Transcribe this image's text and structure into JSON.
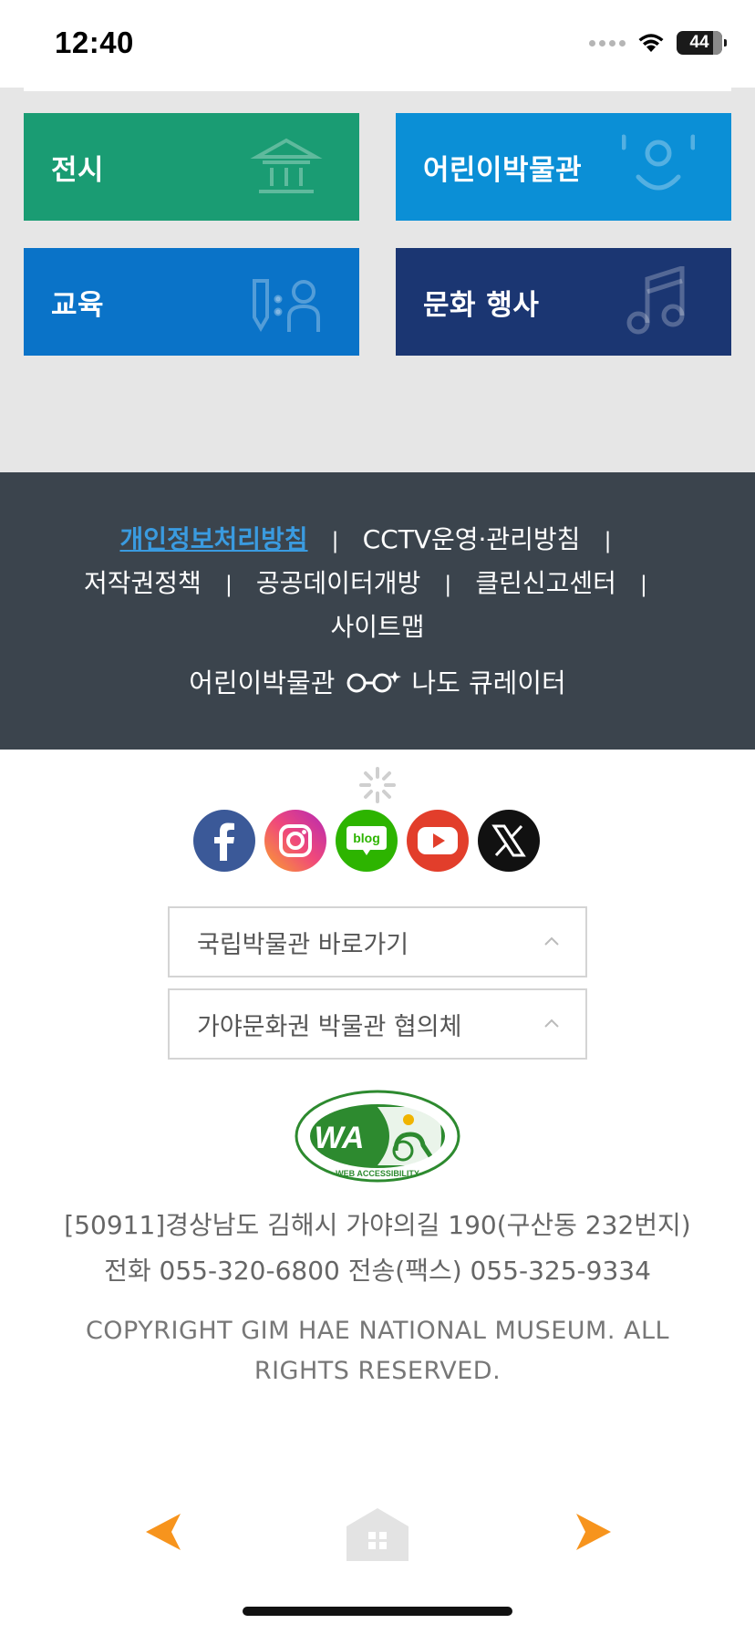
{
  "status_bar": {
    "time": "12:40",
    "battery": "44"
  },
  "tiles": [
    {
      "label": "전시",
      "icon": "museum-building-icon",
      "color": "#1a9c73"
    },
    {
      "label": "어린이박물관",
      "icon": "smiley-face-icon",
      "color": "#0b8fd6"
    },
    {
      "label": "교육",
      "icon": "pencil-person-icon",
      "color": "#0a73c8"
    },
    {
      "label": "문화 행사",
      "icon": "music-note-icon",
      "color": "#1b3672"
    }
  ],
  "footer_links": {
    "privacy": "개인정보처리방침",
    "cctv": "CCTV운영·관리방침",
    "copyright_policy": "저작권정책",
    "open_data": "공공데이터개방",
    "clean_report": "클린신고센터",
    "sitemap": "사이트맵",
    "separator": "|"
  },
  "kids_curator": {
    "left": "어린이박물관",
    "right": "나도 큐레이터"
  },
  "social": [
    "facebook-icon",
    "instagram-icon",
    "blog-icon",
    "youtube-icon",
    "x-icon"
  ],
  "blog_label": "blog",
  "selects": [
    {
      "label": "국립박물관 바로가기"
    },
    {
      "label": "가야문화권 박물관 협의체"
    }
  ],
  "wa_logo": {
    "text": "WA",
    "ring_text": "WEB ACCESSIBILITY"
  },
  "address": {
    "line1": "[50911]경상남도 김해시 가야의길 190(구산동 232번지)",
    "line2": "전화 055-320-6800 전송(팩스) 055-325-9334"
  },
  "copyright": "COPYRIGHT GIM HAE NATIONAL MUSEUM. ALL RIGHTS RESERVED.",
  "colors": {
    "accent_link": "#3a9be0",
    "footer_bg": "#3b444d",
    "nav_arrow": "#f7941d"
  }
}
